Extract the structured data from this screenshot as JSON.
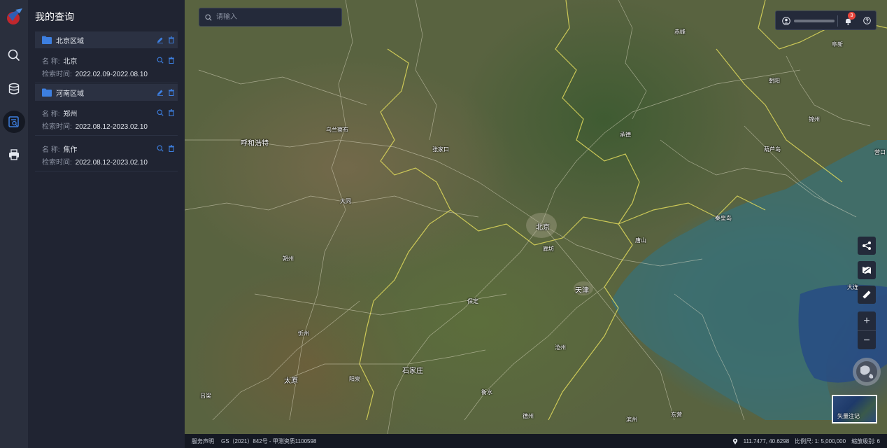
{
  "sidebar": {
    "nav": [
      {
        "icon": "search-icon"
      },
      {
        "icon": "database-icon"
      },
      {
        "icon": "my-query-icon"
      },
      {
        "icon": "printer-icon"
      }
    ]
  },
  "panel": {
    "title": "我的查询",
    "name_label": "名 称:",
    "time_label": "检索时间:",
    "groups": [
      {
        "name": "北京区域",
        "items": [
          {
            "name": "北京",
            "time": "2022.02.09-2022.08.10"
          }
        ]
      },
      {
        "name": "河南区域",
        "items": [
          {
            "name": "郑州",
            "time": "2022.08.12-2023.02.10"
          },
          {
            "name": "焦作",
            "time": "2022.08.12-2023.02.10"
          }
        ]
      }
    ]
  },
  "search": {
    "placeholder": "请输入"
  },
  "header": {
    "notification_count": "3"
  },
  "map": {
    "labels": {
      "beijing": "北京",
      "tianjin": "天津",
      "shijiazhuang": "石家庄",
      "taiyuan": "太原",
      "hohhot": "呼和浩特",
      "datong": "大同",
      "zhangjiakou": "张家口",
      "chengde": "承德",
      "baoding": "保定",
      "langfang": "廊坊",
      "tangshan": "唐山",
      "qinhuangdao": "秦皇岛",
      "huludao": "葫芦岛",
      "jinzhou": "锦州",
      "chaoyang": "朝阳",
      "chifeng": "赤峰",
      "fuxin": "阜新",
      "yingkou": "营口",
      "dalian": "大连",
      "cangzhou": "沧州",
      "hengshui": "衡水",
      "dezhou": "德州",
      "binzhou": "滨州",
      "dongying": "东营",
      "yangquan": "阳泉",
      "xinzhou": "忻州",
      "shuozhou": "朔州",
      "lvliang": "吕梁",
      "ulanqab": "乌兰察布"
    },
    "layer_label": "矢量注记",
    "zoom_in": "+",
    "zoom_out": "−"
  },
  "footer": {
    "service": "服务声明",
    "license": "GS（2021）842号 - 甲测资质1100598",
    "coords": "111.7477, 40.6298",
    "scale": "比例尺: 1: 5,000,000",
    "zoom_level": "缩放级别: 6"
  },
  "colors": {
    "accent": "#3d7fe0",
    "border_yellow": "#d8d35a"
  }
}
